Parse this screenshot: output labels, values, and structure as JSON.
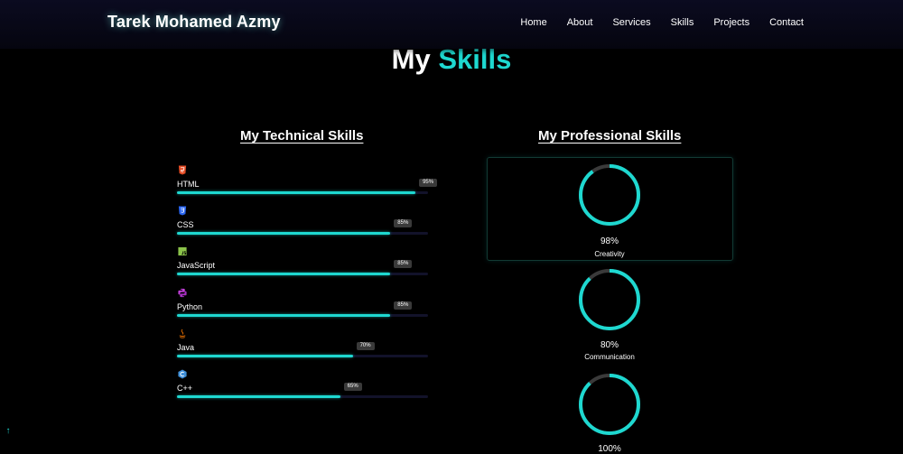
{
  "navbar": {
    "brand": "Tarek Mohamed Azmy",
    "links": [
      "Home",
      "About",
      "Services",
      "Skills",
      "Projects",
      "Contact"
    ]
  },
  "section": {
    "title_main": "My",
    "title_accent": "Skills"
  },
  "technical": {
    "title": "My Technical Skills",
    "skills": [
      {
        "name": "HTML",
        "percent": "95%",
        "value": 95,
        "icon": "html5-icon",
        "color": "#e44d26"
      },
      {
        "name": "CSS",
        "percent": "85%",
        "value": 85,
        "icon": "css3-icon",
        "color": "#2965f1"
      },
      {
        "name": "JavaScript",
        "percent": "85%",
        "value": 85,
        "icon": "javascript-icon",
        "color": "#8bc34a"
      },
      {
        "name": "Python",
        "percent": "85%",
        "value": 85,
        "icon": "python-icon",
        "color": "#c13fd8"
      },
      {
        "name": "Java",
        "percent": "70%",
        "value": 70,
        "icon": "java-icon",
        "color": "#e76f00"
      },
      {
        "name": "C++",
        "percent": "65%",
        "value": 65,
        "icon": "cplusplus-icon",
        "color": "#3f8fd8"
      }
    ]
  },
  "professional": {
    "title": "My Professional Skills",
    "skills": [
      {
        "name": "Creativity",
        "percent": "98%",
        "value": 90
      },
      {
        "name": "Communication",
        "percent": "80%",
        "value": 88
      },
      {
        "name": "",
        "percent": "100%",
        "value": 88
      }
    ]
  },
  "colors": {
    "accent": "#1ed8d0",
    "background": "#000000"
  }
}
